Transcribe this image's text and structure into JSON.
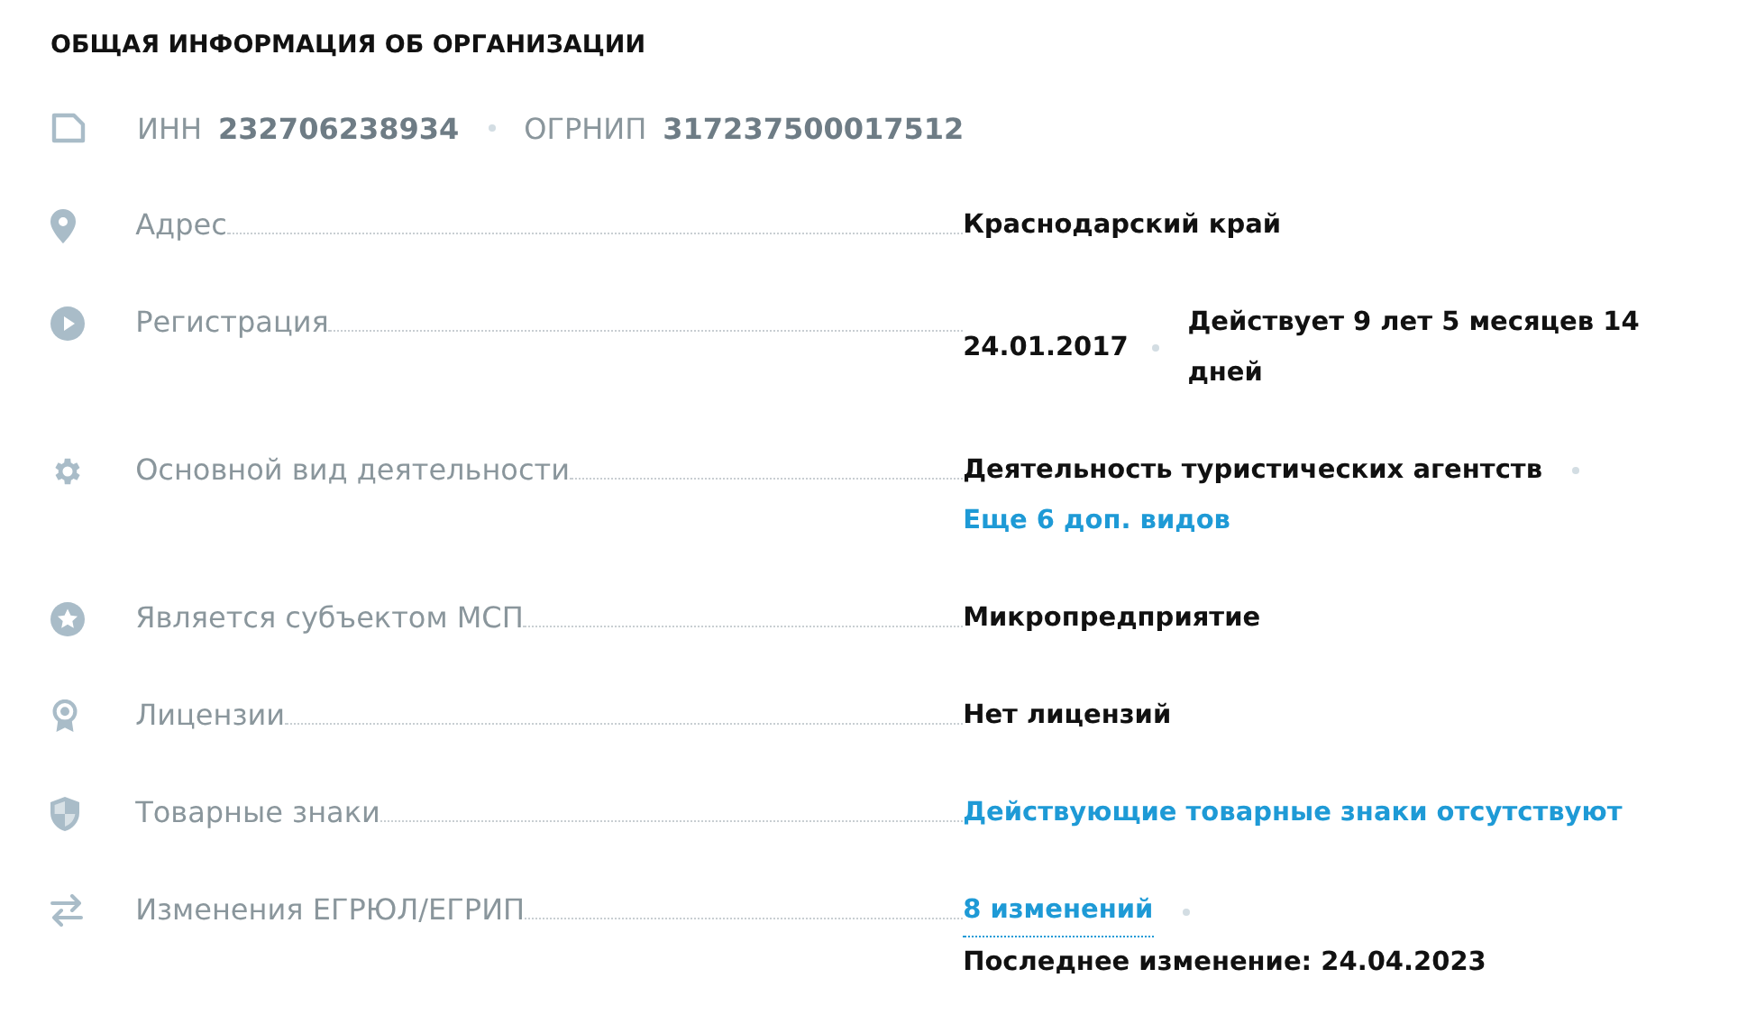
{
  "title": "ОБЩАЯ ИНФОРМАЦИЯ ОБ ОРГАНИЗАЦИИ",
  "identifiers": [
    {
      "label": "ИНН",
      "value": "232706238934"
    },
    {
      "label": "ОГРНИП",
      "value": "317237500017512"
    }
  ],
  "rows": [
    {
      "label": "Адрес",
      "lines": [
        [
          {
            "kind": "text",
            "text": "Краснодарский край",
            "dot_after": false
          }
        ]
      ]
    },
    {
      "label": "Регистрация",
      "lines": [
        [
          {
            "kind": "text",
            "text": "24.01.2017",
            "dot_after": true
          },
          {
            "kind": "text",
            "text": "Действует 9 лет 5 месяцев 14 дней",
            "dot_after": false
          }
        ]
      ]
    },
    {
      "label": "Основной вид деятельности",
      "lines": [
        [
          {
            "kind": "text",
            "text": "Деятельность туристических агентств",
            "dot_after": true
          }
        ],
        [
          {
            "kind": "link",
            "text": "Еще 6 доп. видов",
            "dot_after": false
          }
        ]
      ]
    },
    {
      "label": "Является субъектом МСП",
      "lines": [
        [
          {
            "kind": "text",
            "text": "Микропредприятие",
            "dot_after": false
          }
        ]
      ]
    },
    {
      "label": "Лицензии",
      "lines": [
        [
          {
            "kind": "text",
            "text": "Нет лицензий",
            "dot_after": false
          }
        ]
      ]
    },
    {
      "label": "Товарные знаки",
      "lines": [
        [
          {
            "kind": "link",
            "text": "Действующие товарные знаки отсутствуют",
            "dot_after": false
          }
        ]
      ]
    },
    {
      "label": "Изменения ЕГРЮЛ/ЕГРИП",
      "lines": [
        [
          {
            "kind": "dotted_link",
            "text": "8 изменений",
            "dot_after": true
          }
        ],
        [
          {
            "kind": "text",
            "text": "Последнее изменение:  24.04.2023",
            "dot_after": false
          }
        ]
      ]
    }
  ]
}
